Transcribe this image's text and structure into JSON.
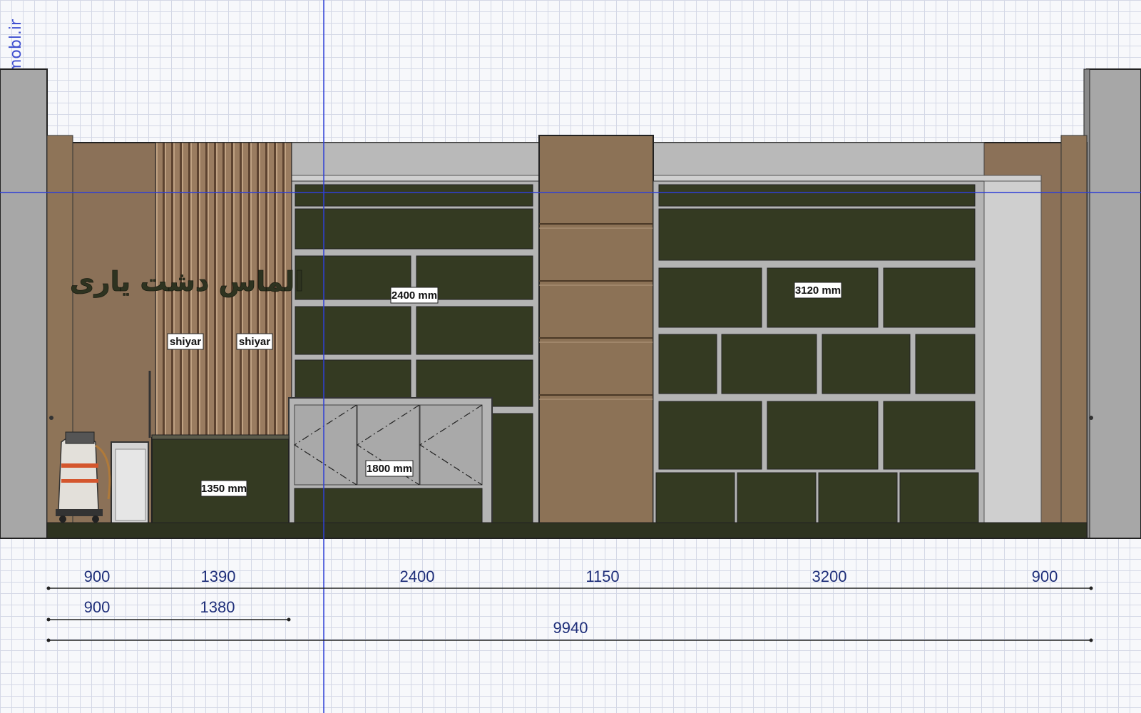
{
  "watermark": "dmobl.ir",
  "sign_text": "الماس دشت یاری",
  "labels": {
    "slat_left": "shiyar",
    "slat_right": "shiyar",
    "counter": "1350 mm",
    "left_shelves": "2400 mm",
    "display_case": "1800 mm",
    "right_shelves": "3120 mm"
  },
  "dimensions": {
    "row1": [
      "900",
      "1390",
      "2400",
      "1150",
      "3200",
      "900"
    ],
    "row2": [
      "900",
      "1380"
    ],
    "total": "9940"
  },
  "colors": {
    "wall_tan": "#8b7158",
    "shelf_dark": "#343a22",
    "frame_grey": "#b4b4b4",
    "column_wood": "#8c7256",
    "guide_blue": "#2f3fd6",
    "dim_text": "#1f2f7a"
  }
}
